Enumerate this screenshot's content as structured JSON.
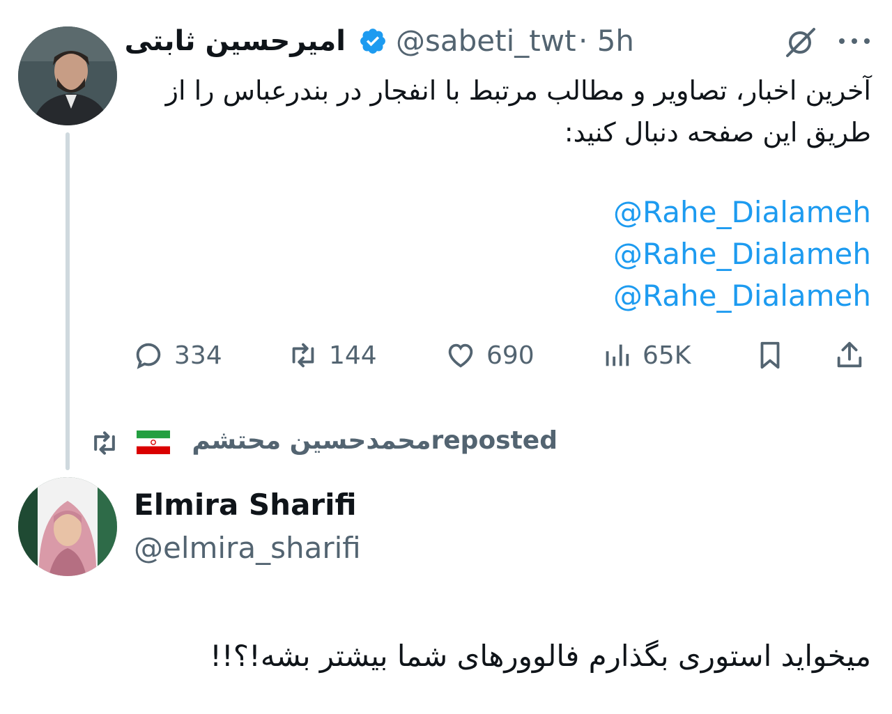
{
  "tweet": {
    "author_name": "امیرحسین ثابتی",
    "handle": "@sabeti_twt",
    "time": "· 5h",
    "text": "آخرین اخبار، تصاویر و مطالب مرتبط با انفجار در بندرعباس را از طریق این صفحه دنبال کنید:",
    "mentions": [
      "@Rahe_Dialameh",
      "@Rahe_Dialameh",
      "@Rahe_Dialameh"
    ],
    "stats": {
      "replies": "334",
      "reposts": "144",
      "likes": "690",
      "views": "65K"
    },
    "colors": {
      "accent": "#1d9bf0",
      "muted": "#536471",
      "text": "#0f1419",
      "thread_line": "#cfd9de"
    },
    "icons": [
      "verified-badge-icon",
      "grok-icon",
      "more-icon",
      "reply-icon",
      "repost-icon",
      "like-icon",
      "views-icon",
      "bookmark-icon",
      "share-icon"
    ]
  },
  "repost_context": {
    "text": "محمدحسین محتشمreposted",
    "flag": "iran-flag-icon"
  },
  "second_tweet": {
    "name": "Elmira Sharifi",
    "handle": "@elmira_sharifi",
    "text": "میخواید استوری بگذارم فالوورهای شما بیشتر بشه!؟!!"
  }
}
